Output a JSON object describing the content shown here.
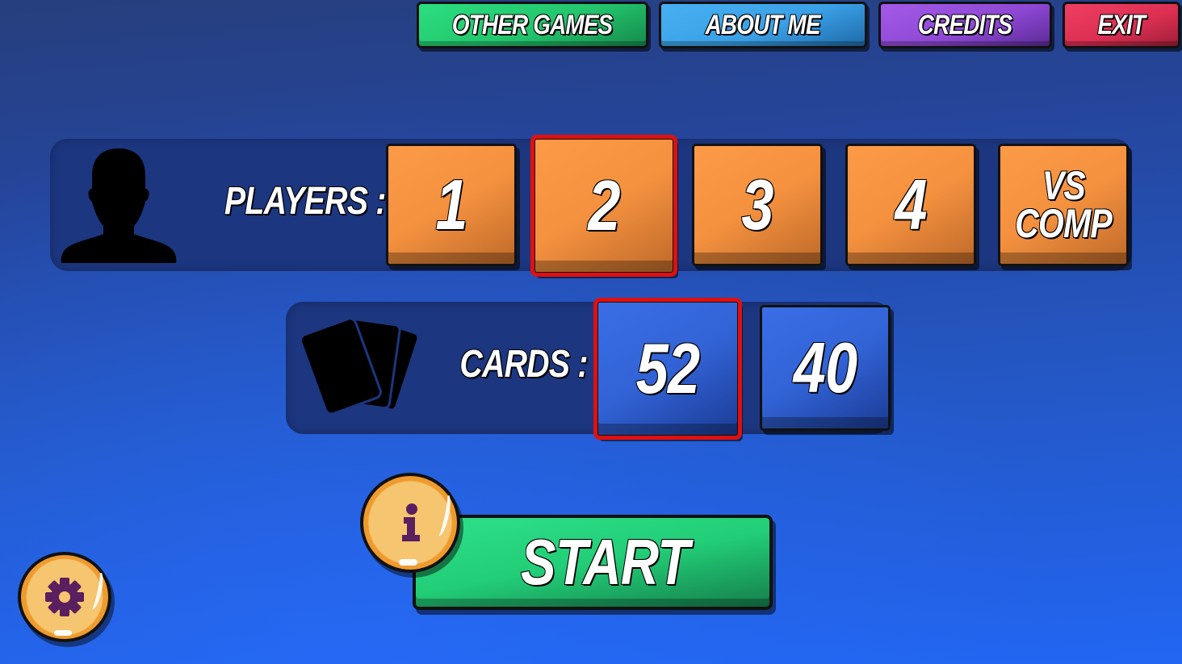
{
  "top_menu": {
    "other_games": "Other Games",
    "about_me": "About Me",
    "credits": "Credits",
    "exit": "Exit"
  },
  "players": {
    "label": "Players :",
    "icon": "person-silhouette-icon",
    "options": [
      "1",
      "2",
      "3",
      "4"
    ],
    "vs_comp": {
      "line1": "VS",
      "line2": "COMP"
    },
    "selected": "2"
  },
  "cards": {
    "label": "Cards :",
    "icon": "card-deck-icon",
    "options": [
      "52",
      "40"
    ],
    "selected": "52"
  },
  "start": {
    "label": "Start"
  },
  "info_button": {
    "icon": "info-icon"
  },
  "settings_button": {
    "icon": "gear-icon"
  },
  "colors": {
    "orange_tile": "#f4913f",
    "blue_tile": "#3263d6",
    "selected_outline": "#e01010",
    "start_green": "#22cd77",
    "panel": "#1c3680",
    "coin_outer": "#ef9a2c",
    "coin_inner": "#f6c570",
    "icon_purple": "#5a1f5e"
  }
}
